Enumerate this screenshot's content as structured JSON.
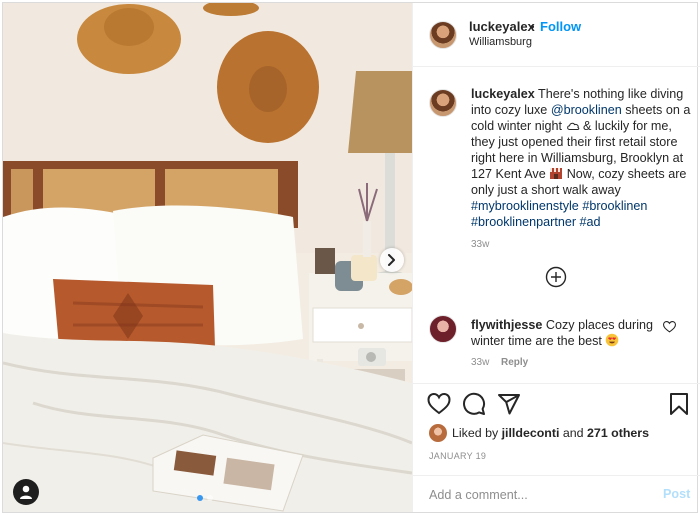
{
  "header": {
    "username": "luckeyalex",
    "separator": "•",
    "follow_label": "Follow",
    "location": "Williamsburg",
    "avatar_icon": "profile-avatar"
  },
  "caption": {
    "username": "luckeyalex",
    "part1": "There's nothing like diving into cozy luxe",
    "mention": "@brooklinen",
    "part2": "sheets on a cold winter night",
    "part3": "& luckily for me, they just opened their first retail store right here in Williamsburg, Brooklyn at 127 Kent Ave",
    "part4": "Now, cozy sheets are only just a short walk away",
    "hashtag1": "#mybrooklinenstyle",
    "hashtag2": "#brooklinen",
    "hashtag3": "#brooklinenpartner",
    "hashtag4": "#ad",
    "time": "33w",
    "emoji1": "cloud-emoji",
    "emoji2": "shop-emoji"
  },
  "load_more_icon": "plus-circle-icon",
  "comment": {
    "username": "flywithjesse",
    "text": "Cozy places during winter time are the best",
    "emoji": "heart-eyes-emoji",
    "time": "33w",
    "reply_label": "Reply"
  },
  "actions": {
    "like_icon": "heart-icon",
    "comment_icon": "comment-icon",
    "share_icon": "share-icon",
    "save_icon": "bookmark-icon"
  },
  "likes": {
    "prefix": "Liked by",
    "user": "jilldeconti",
    "middle": "and",
    "others": "271 others"
  },
  "date": "JANUARY 19",
  "comment_box": {
    "placeholder": "Add a comment...",
    "post_label": "Post"
  },
  "carousel": {
    "slide_count": 2,
    "active_slide": 1
  },
  "colors": {
    "follow_blue": "#0095f6",
    "link_blue": "#00376b",
    "muted_gray": "#8e8e8e",
    "post_disabled": "#b2dffc",
    "carousel_dot_active": "#3897f0"
  }
}
